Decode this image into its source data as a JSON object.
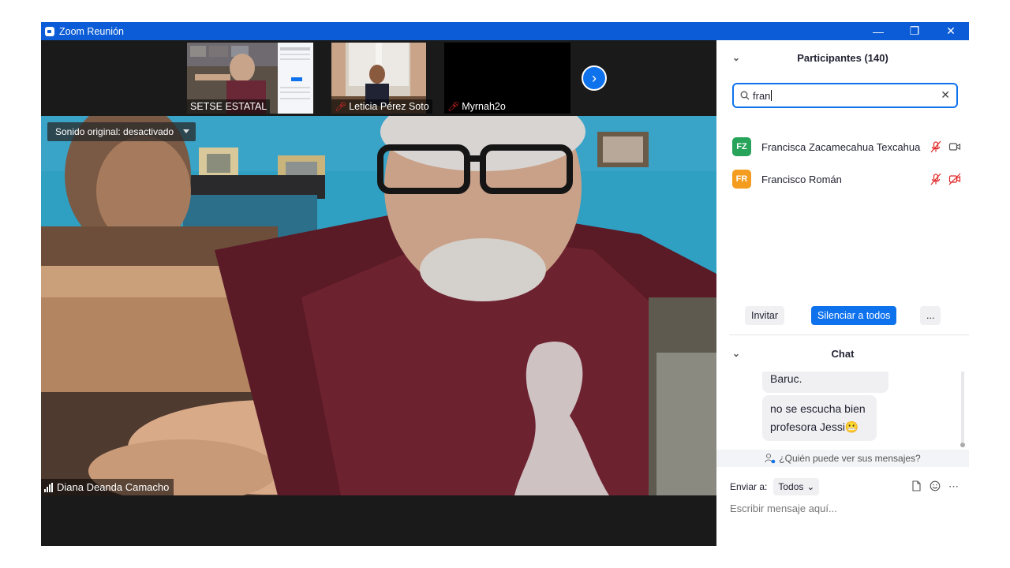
{
  "window": {
    "title": "Zoom Reunión"
  },
  "thumbnails": [
    {
      "name": "SETSE ESTATAL",
      "muted": false
    },
    {
      "name": "Leticia Pérez Soto",
      "muted": true
    },
    {
      "name": "Myrnah2o",
      "muted": true
    }
  ],
  "main_video": {
    "sound_option": "Sonido original: desactivado",
    "speaker_name": "Diana Deanda Camacho"
  },
  "participants": {
    "title": "Participantes (140)",
    "search_value": "fran",
    "items": [
      {
        "initials": "FZ",
        "name": "Francisca Zacamecahua Texcahua",
        "color": "#27a35a",
        "muted": true,
        "video_on": true
      },
      {
        "initials": "FR",
        "name": "Francisco Román",
        "color": "#f39c1f",
        "muted": true,
        "video_on": false
      }
    ],
    "buttons": {
      "invite": "Invitar",
      "mute_all": "Silenciar a todos",
      "more": "..."
    }
  },
  "chat": {
    "title": "Chat",
    "messages": [
      "Baruc.",
      "no se escucha bien profesora Jessi😬"
    ],
    "who_can_see": "¿Quién puede ver sus mensajes?",
    "send_to_label": "Enviar a:",
    "send_to_value": "Todos",
    "input_placeholder": "Escribir mensaje aquí..."
  }
}
